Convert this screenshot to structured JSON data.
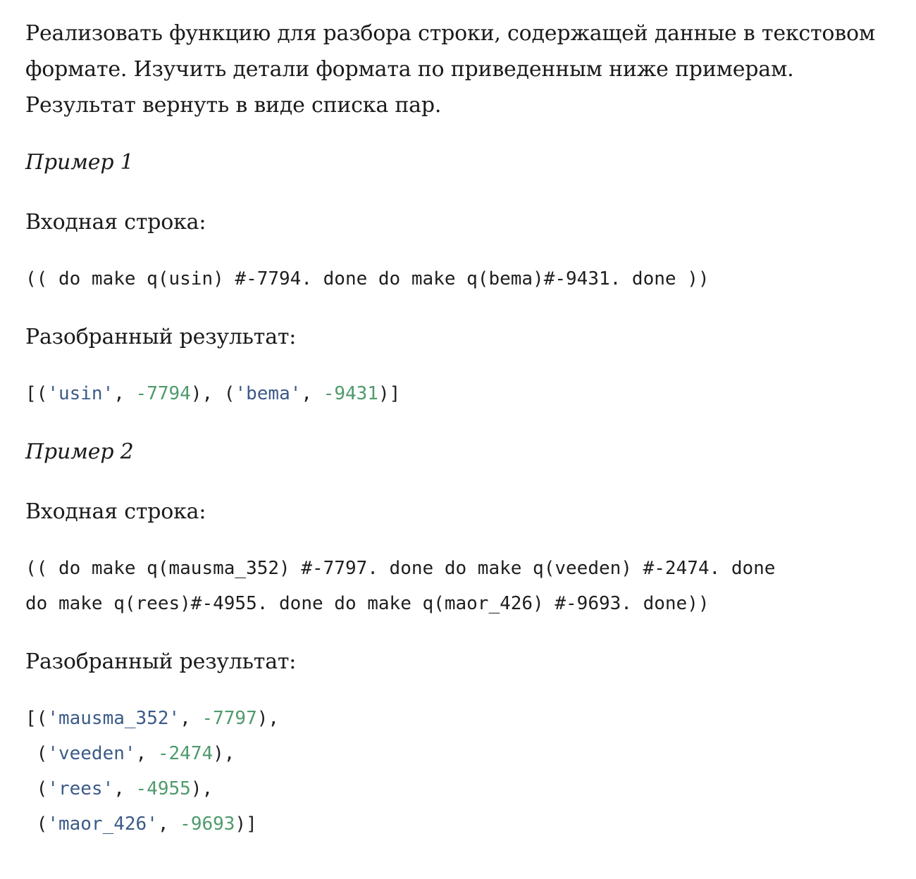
{
  "intro": {
    "line1": "Реализовать функцию для разбора строки, содержащей данные в текстовом",
    "line2": "формате. Изучить детали формата по приведенным ниже примерам.",
    "line3": "Результат вернуть в виде списка пар."
  },
  "examples": [
    {
      "title": "Пример 1",
      "input_label": "Входная строка:",
      "input_lines": [
        "(( do make q(usin) #-7794. done do make q(bema)#-9431. done ))"
      ],
      "result_label": "Разобранный результат:",
      "result_pairs": [
        {
          "open": "[(",
          "key": "'usin'",
          "sep": ", ",
          "value": "-7794",
          "close": "), "
        },
        {
          "open": "(",
          "key": "'bema'",
          "sep": ", ",
          "value": "-9431",
          "close": ")]"
        }
      ]
    },
    {
      "title": "Пример 2",
      "input_label": "Входная строка:",
      "input_lines": [
        "(( do make q(mausma_352) #-7797. done do make q(veeden) #-2474. done",
        "do make q(rees)#-4955. done do make q(maor_426) #-9693. done))"
      ],
      "result_label": "Разобранный результат:",
      "result_pairs": [
        {
          "open": "[(",
          "key": "'mausma_352'",
          "sep": ", ",
          "value": "-7797",
          "close": "),"
        },
        {
          "open": " (",
          "key": "'veeden'",
          "sep": ", ",
          "value": "-2474",
          "close": "),"
        },
        {
          "open": " (",
          "key": "'rees'",
          "sep": ", ",
          "value": "-4955",
          "close": "),"
        },
        {
          "open": " (",
          "key": "'maor_426'",
          "sep": ", ",
          "value": "-9693",
          "close": ")]"
        }
      ]
    }
  ],
  "colors": {
    "string": "#3b5b88",
    "number": "#4f9a6c",
    "text": "#1a1a1a"
  }
}
